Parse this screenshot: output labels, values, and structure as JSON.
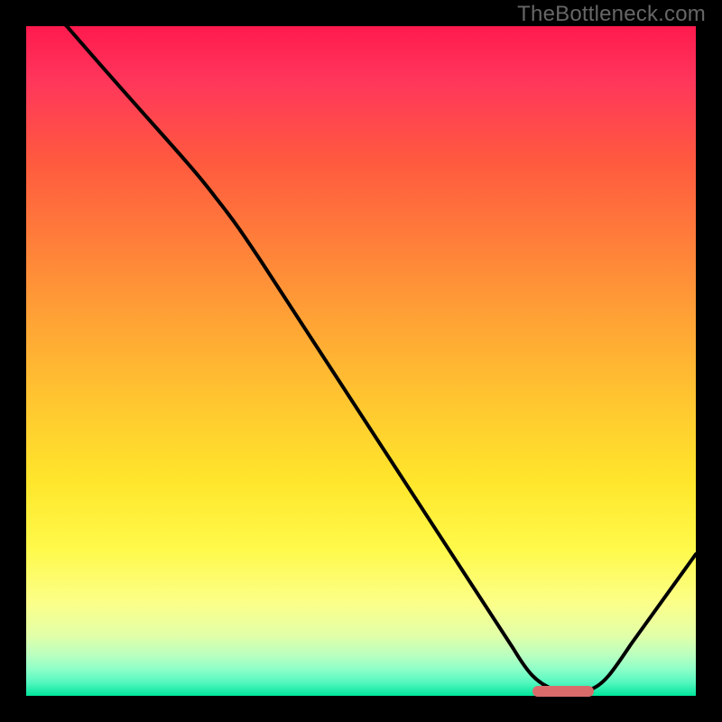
{
  "watermark": "TheBottleneck.com",
  "chart_data": {
    "type": "line",
    "title": "",
    "xlabel": "",
    "ylabel": "",
    "xlim": [
      0,
      100
    ],
    "ylim": [
      0,
      100
    ],
    "x": [
      0,
      6,
      24,
      30,
      74,
      78,
      84,
      100
    ],
    "values": [
      105,
      100,
      80,
      76,
      6,
      0,
      0,
      20
    ],
    "note": "values are approximate heights read from the curve as % from bottom; curve starts above visible top",
    "optimal_marker": {
      "x_start": 76,
      "x_end": 85,
      "y": 0
    },
    "gradient_stops": [
      {
        "pos": 0,
        "color": "#ff1a4d"
      },
      {
        "pos": 50,
        "color": "#ffb030"
      },
      {
        "pos": 80,
        "color": "#fff94a"
      },
      {
        "pos": 100,
        "color": "#00e59a"
      }
    ]
  }
}
